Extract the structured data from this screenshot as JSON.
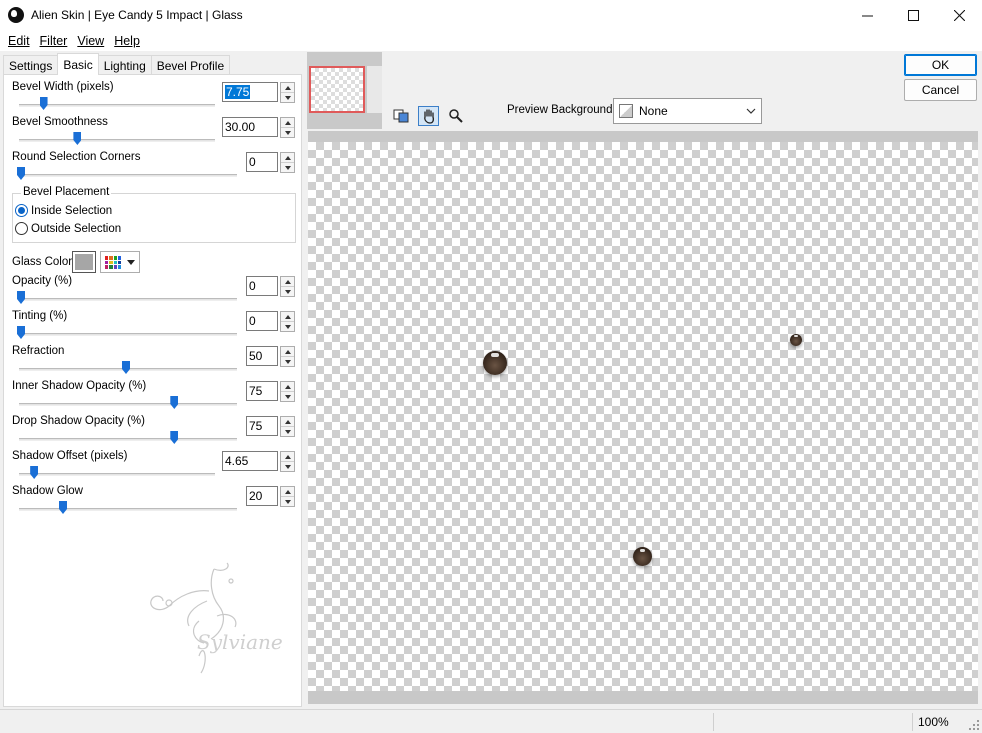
{
  "window": {
    "title": "Alien Skin | Eye Candy 5 Impact | Glass"
  },
  "menu": [
    "Edit",
    "Filter",
    "View",
    "Help"
  ],
  "tabs": [
    "Settings",
    "Basic",
    "Lighting",
    "Bevel Profile"
  ],
  "active_tab": "Basic",
  "params": {
    "bevel_width": {
      "label": "Bevel Width (pixels)",
      "value": "7.75",
      "level": 0.12
    },
    "bevel_smoothness": {
      "label": "Bevel Smoothness",
      "value": "30.00",
      "level": 0.3
    },
    "round_corners": {
      "label": "Round Selection Corners",
      "value": "0",
      "level": 0.0
    },
    "opacity": {
      "label": "Opacity (%)",
      "value": "0",
      "level": 0.0
    },
    "tinting": {
      "label": "Tinting (%)",
      "value": "0",
      "level": 0.0
    },
    "refraction": {
      "label": "Refraction",
      "value": "50",
      "level": 0.5
    },
    "inner_shadow": {
      "label": "Inner Shadow Opacity (%)",
      "value": "75",
      "level": 0.73
    },
    "drop_shadow": {
      "label": "Drop Shadow Opacity (%)",
      "value": "75",
      "level": 0.73
    },
    "shadow_offset": {
      "label": "Shadow Offset (pixels)",
      "value": "4.65",
      "level": 0.07
    },
    "shadow_glow": {
      "label": "Shadow Glow",
      "value": "20",
      "level": 0.2
    }
  },
  "bevel_placement": {
    "legend": "Bevel Placement",
    "inside": "Inside Selection",
    "outside": "Outside Selection",
    "selected": "inside"
  },
  "glass_color": {
    "label": "Glass Color",
    "swatch": "#a6a6a6"
  },
  "watermark": {
    "text": "Sylviane"
  },
  "preview_background": {
    "label": "Preview Background:",
    "value": "None"
  },
  "buttons": {
    "ok": "OK",
    "cancel": "Cancel"
  },
  "status": {
    "zoom": "100%"
  },
  "colors": {
    "accent": "#0078d7",
    "slider": "#1a6fd6",
    "bead": "#3d2d22"
  }
}
